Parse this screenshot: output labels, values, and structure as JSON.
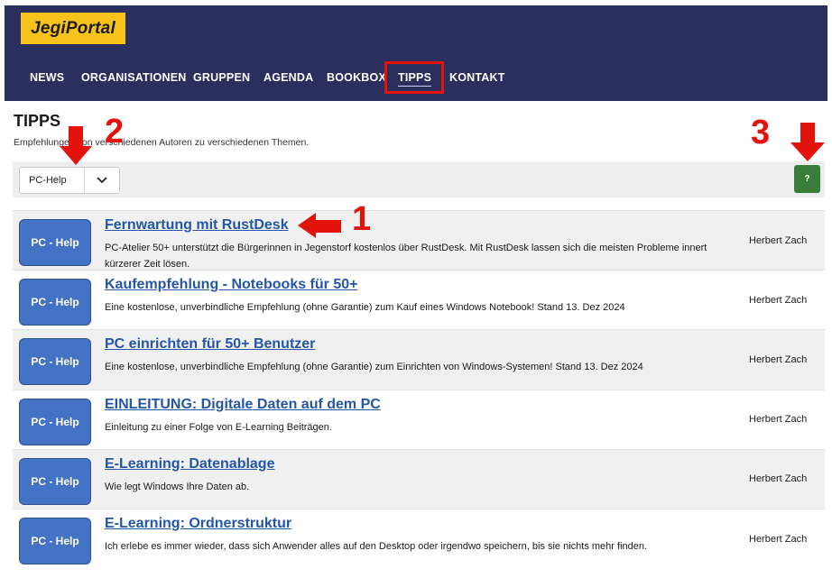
{
  "header": {
    "logo": "JegiPortal",
    "nav": [
      {
        "label": "NEWS"
      },
      {
        "label": "ORGANISATIONEN"
      },
      {
        "label": "GRUPPEN"
      },
      {
        "label": "AGENDA"
      },
      {
        "label": "BOOKBOX"
      },
      {
        "label": "TIPPS",
        "active": true
      },
      {
        "label": "KONTAKT"
      }
    ]
  },
  "page": {
    "title": "TIPPS",
    "subtitle": "Empfehlungen von verschiedenen Autoren zu verschiedenen Themen."
  },
  "toolbar": {
    "filter_value": "PC-Help",
    "help_label": "?"
  },
  "items": [
    {
      "badge": "PC - Help",
      "title": "Fernwartung mit RustDesk",
      "desc": "PC-Atelier 50+ unterstützt die Bürgerinnen in Jegenstorf kostenlos über RustDesk. Mit RustDesk lassen sich die meisten Probleme innert kürzerer Zeit lösen.",
      "author": "Herbert Zach"
    },
    {
      "badge": "PC - Help",
      "title": "Kaufempfehlung - Notebooks für 50+",
      "desc": "Eine kostenlose, unverbindliche Empfehlung (ohne Garantie) zum Kauf eines Windows Notebook! Stand 13. Dez 2024",
      "author": "Herbert Zach"
    },
    {
      "badge": "PC - Help",
      "title": "PC einrichten für 50+ Benutzer",
      "desc": "Eine kostenlose, unverbindliche Empfehlung (ohne Garantie) zum Einrichten von Windows-Systemen! Stand 13. Dez 2024",
      "author": "Herbert Zach"
    },
    {
      "badge": "PC - Help",
      "title": "EINLEITUNG: Digitale Daten auf dem PC",
      "desc": "Einleitung zu einer Folge von E-Learning Beiträgen.",
      "author": "Herbert Zach"
    },
    {
      "badge": "PC - Help",
      "title": "E-Learning: Datenablage",
      "desc": "Wie legt Windows Ihre Daten ab.",
      "author": "Herbert Zach"
    },
    {
      "badge": "PC - Help",
      "title": "E-Learning: Ordnerstruktur",
      "desc": "Ich erlebe es immer wieder, dass sich Anwender alles auf den Desktop oder irgendwo speichern, bis sie nichts mehr finden.",
      "author": "Herbert Zach"
    }
  ],
  "annotations": {
    "marker_1": "1",
    "marker_2": "2",
    "marker_3": "3",
    "color": "#e3120b"
  }
}
